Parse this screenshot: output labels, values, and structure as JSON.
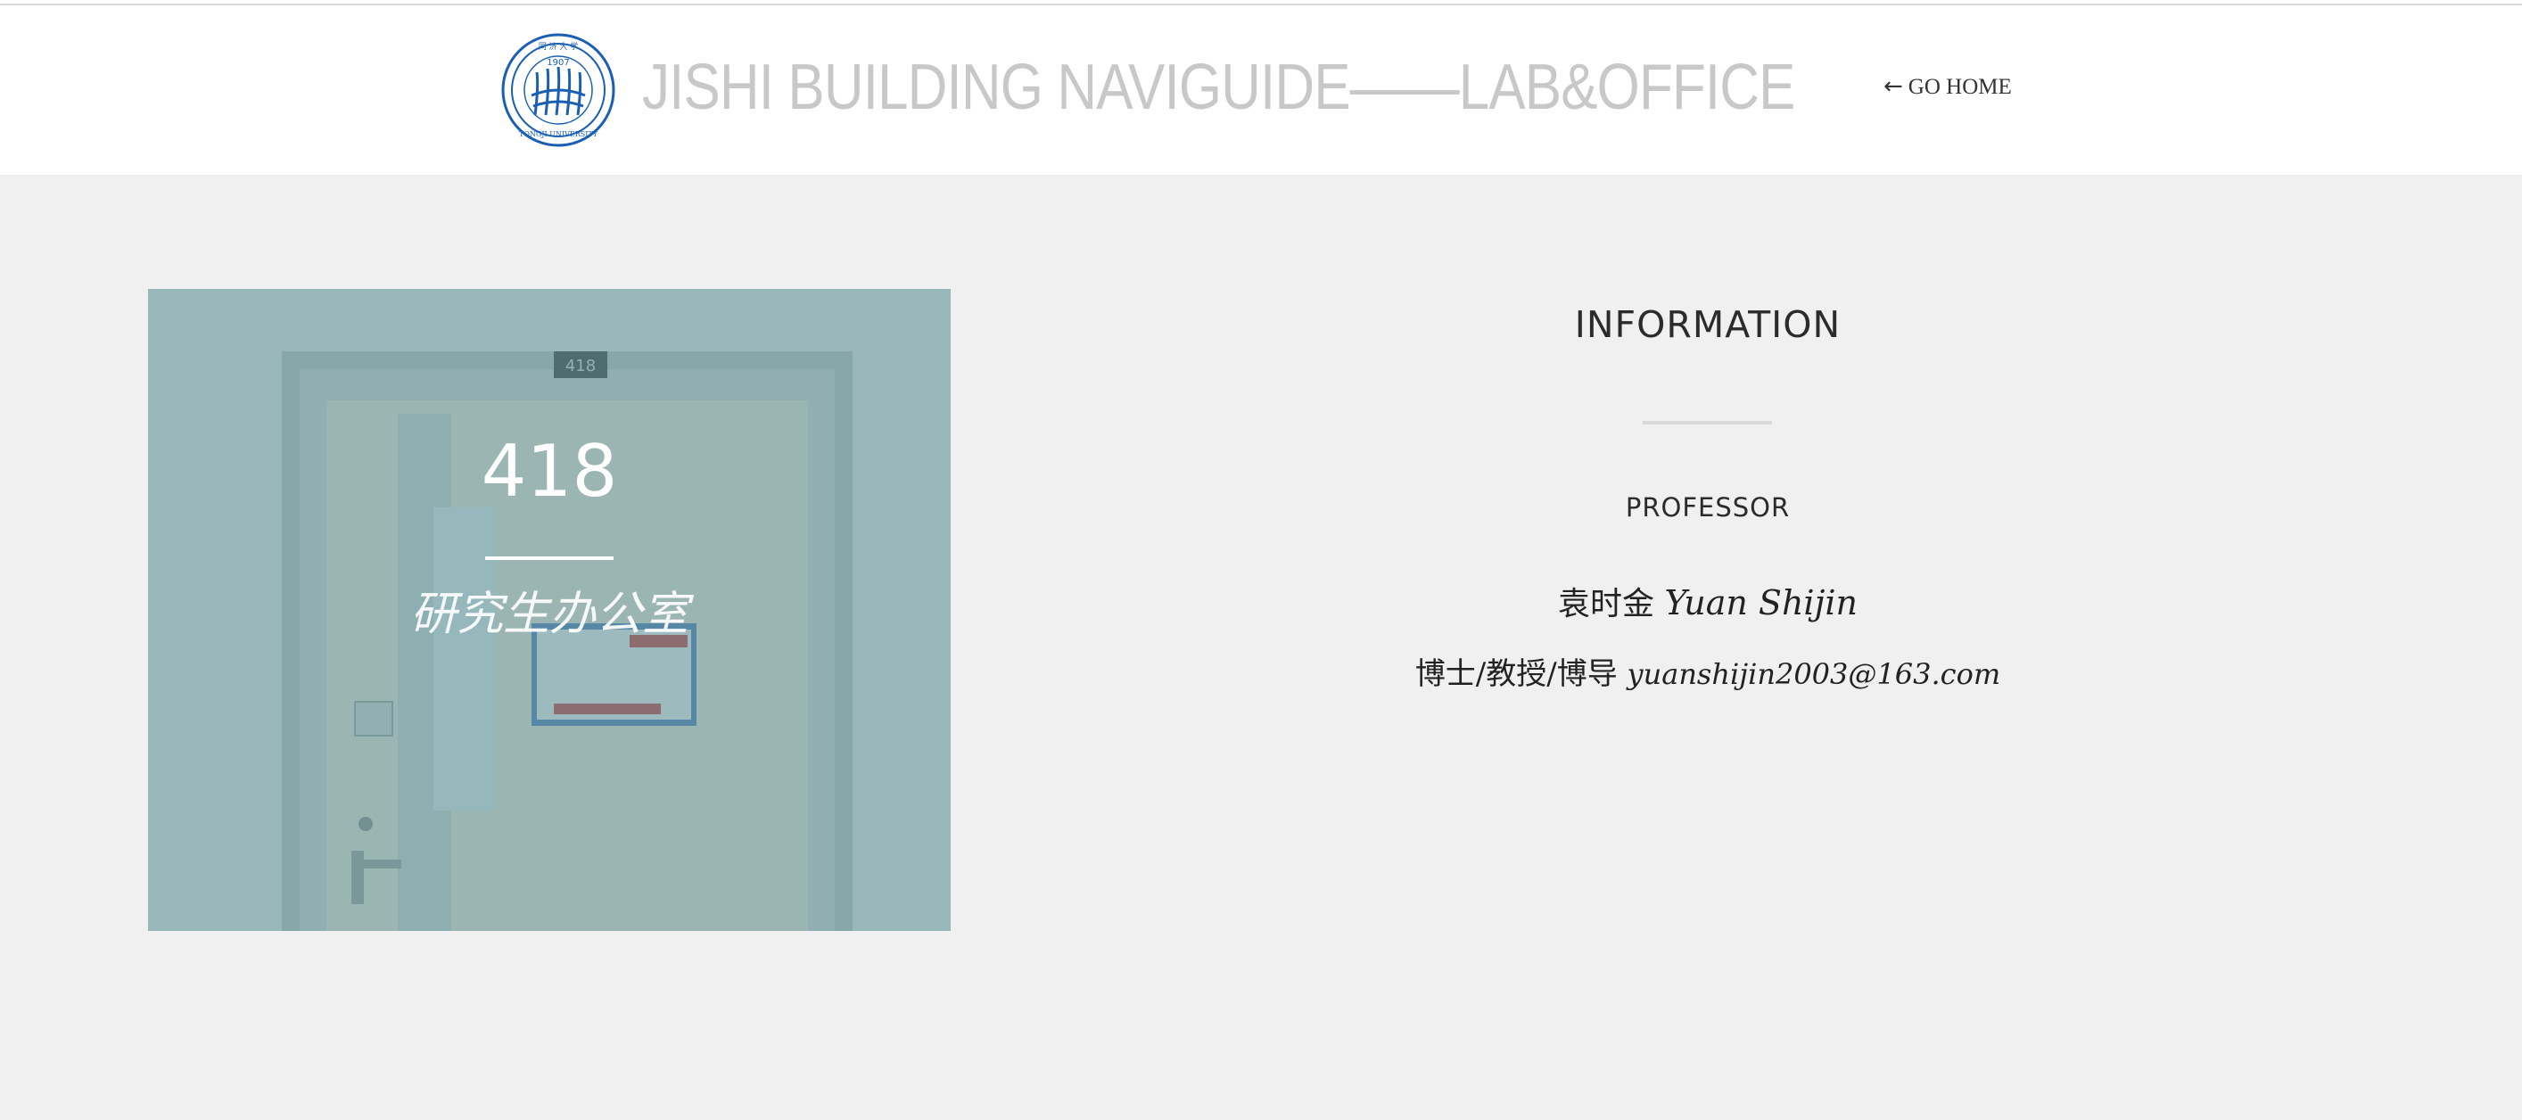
{
  "header": {
    "site_title": "JISHI BUILDING NAVIGUIDE——LAB&OFFICE",
    "go_home": "GO HOME",
    "logo": {
      "icon": "tongji-university-seal",
      "seal_top_text": "同 济 大 学",
      "seal_year": "1907",
      "seal_bottom_text": "TONGJI UNIVERSITY",
      "color": "#1a5fb4"
    }
  },
  "room": {
    "number": "418",
    "name": "研究生办公室",
    "door_plate": "418"
  },
  "info": {
    "title": "INFORMATION",
    "role": "PROFESSOR",
    "name_cn": "袁时金",
    "name_en": "Yuan Shijin",
    "titles": "博士/教授/博导",
    "email": "yuanshijin2003@163.com"
  },
  "colors": {
    "background": "#f0f0f0",
    "header_bg": "#ffffff",
    "title_gray": "#c8c8c8",
    "overlay_teal": "#5f8f96"
  }
}
